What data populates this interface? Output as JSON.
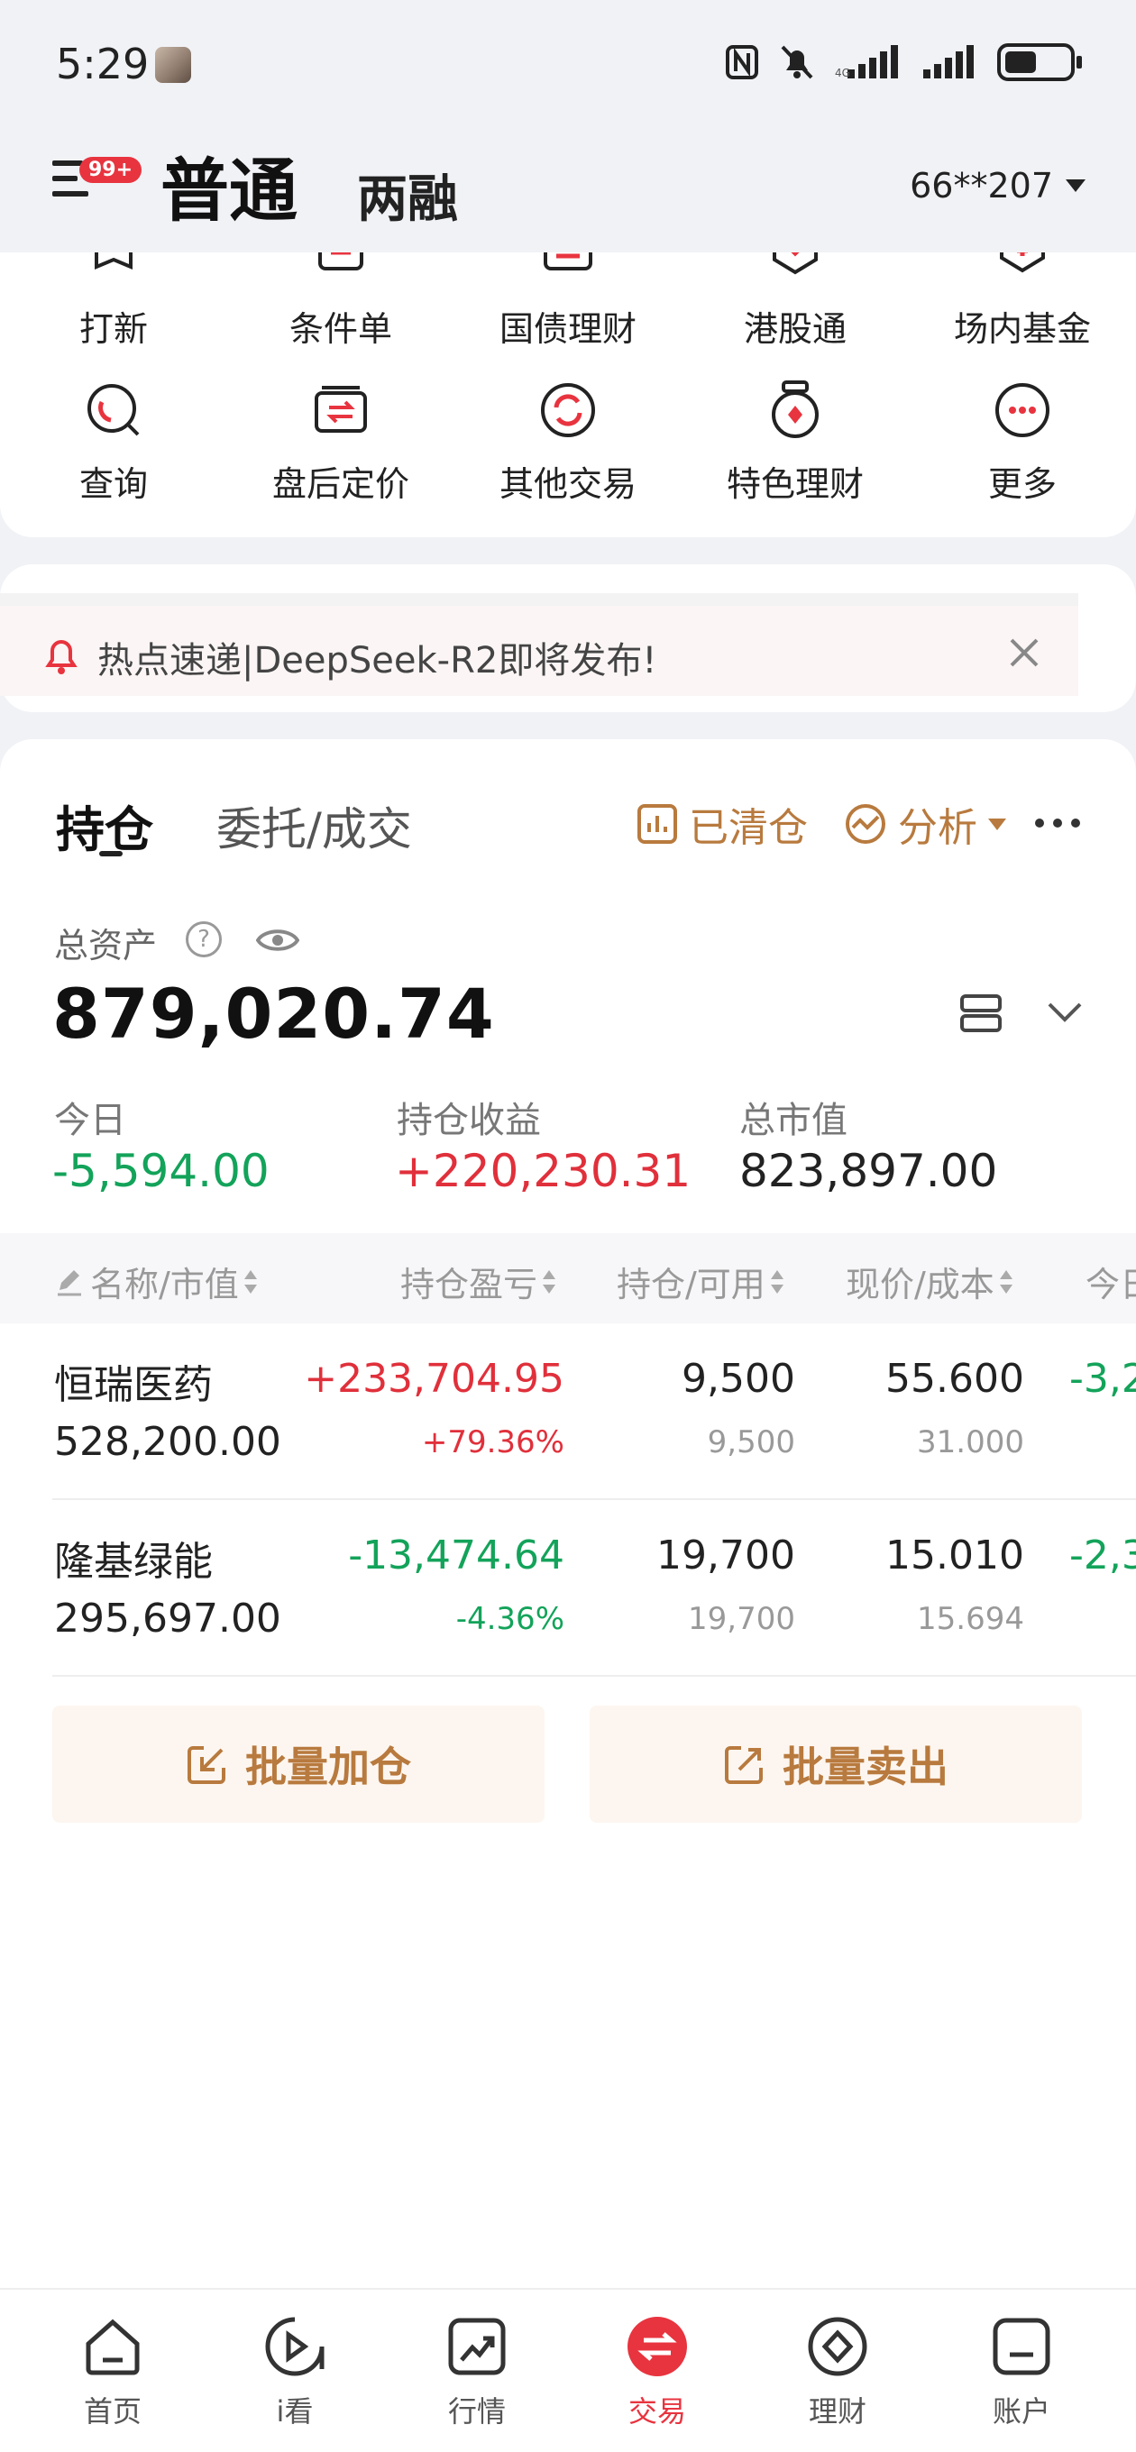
{
  "status_bar": {
    "time": "5:29"
  },
  "header": {
    "menu_badge": "99+",
    "tab_active": "普通",
    "tab_other": "两融",
    "account": "66**207"
  },
  "quick_grid": {
    "row1": [
      "打新",
      "条件单",
      "国债理财",
      "港股通",
      "场内基金"
    ],
    "row2": [
      "查询",
      "盘后定价",
      "其他交易",
      "特色理财",
      "更多"
    ]
  },
  "notice": {
    "text": "热点速递|DeepSeek-R2即将发布!"
  },
  "positions": {
    "tab_holdings": "持仓",
    "tab_orders": "委托/成交",
    "cleared_label": "已清仓",
    "analysis_label": "分析",
    "total_assets_label": "总资产",
    "total_assets_value": "879,020.74",
    "today_label": "今日",
    "today_value": "-5,594.00",
    "profit_label": "持仓收益",
    "profit_value": "+220,230.31",
    "market_value_label": "总市值",
    "market_value_value": "823,897.00",
    "columns": [
      "名称/市值",
      "持仓盈亏",
      "持仓/可用",
      "现价/成本",
      "今日"
    ],
    "rows": [
      {
        "name": "恒瑞医药",
        "market_value": "528,200.00",
        "pl": "+233,704.95",
        "pl_pct": "+79.36%",
        "qty": "9,500",
        "avail": "9,500",
        "price": "55.600",
        "cost": "31.000",
        "today": "-3,2"
      },
      {
        "name": "隆基绿能",
        "market_value": "295,697.00",
        "pl": "-13,474.64",
        "pl_pct": "-4.36%",
        "qty": "19,700",
        "avail": "19,700",
        "price": "15.010",
        "cost": "15.694",
        "today": "-2,3"
      }
    ],
    "batch_add": "批量加仓",
    "batch_sell": "批量卖出"
  },
  "bottom_nav": [
    "首页",
    "i看",
    "行情",
    "交易",
    "理财",
    "账户"
  ],
  "colors": {
    "up": "#e0303b",
    "down": "#13a35a",
    "accent": "#b87a3e",
    "brand": "#e8343f"
  }
}
